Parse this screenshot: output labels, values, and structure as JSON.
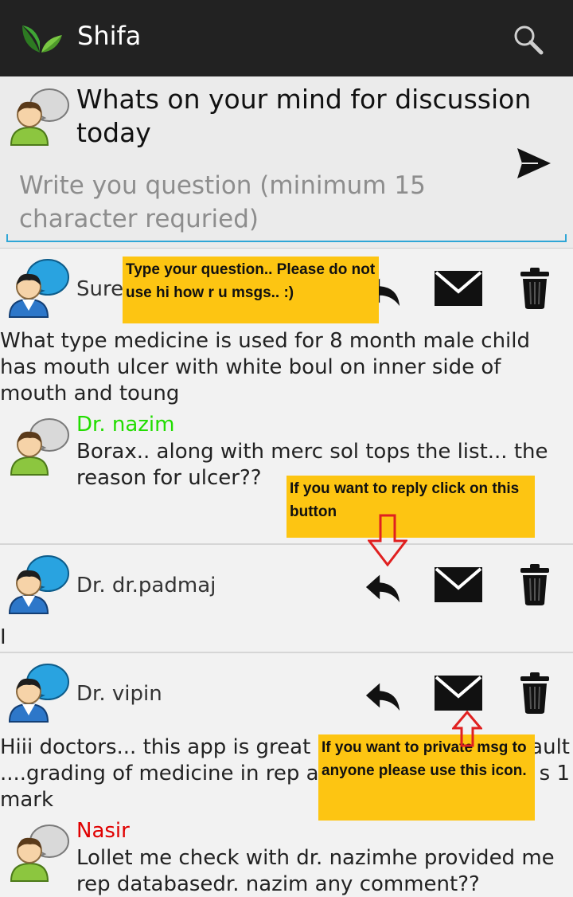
{
  "app": {
    "title": "Shifa",
    "logo_icon": "leaf-icon",
    "search_icon": "search-icon"
  },
  "composer": {
    "heading": "Whats on your mind for discussion today",
    "placeholder": "Write you question (minimum 15 character requried)",
    "send_icon": "send-icon"
  },
  "posts": [
    {
      "author": "Sure",
      "body": "What type medicine is used for 8 month male child has mouth ulcer with white boul on inner side of mouth and toung",
      "replies": [
        {
          "author": "Dr. nazim",
          "author_color": "#22dd00",
          "text": "Borax.. along with merc sol tops the list... the reason for ulcer??"
        }
      ]
    },
    {
      "author": "Dr. dr.padmaj",
      "body": "I",
      "replies": []
    },
    {
      "author": "Dr. vipin",
      "body_line1": "Hiii doctors... this app is great bi",
      "body_line1_end": "ault",
      "body_line2": "....grading of medicine in rep are",
      "body_line2_end": "s 1",
      "body_line3": "mark",
      "replies": [
        {
          "author": "Nasir",
          "author_color": "#e00000",
          "text": "Lollet me check with dr. nazimhe provided me rep databasedr. nazim any comment??"
        }
      ]
    }
  ],
  "icons": {
    "reply": "reply-icon",
    "message": "envelope-icon",
    "delete": "trash-icon",
    "avatar": "user-avatar-icon"
  },
  "callouts": {
    "question": "Type your question.. Please do not use hi how r u msgs.. :)",
    "reply": "If you want to reply click on this button",
    "private": "If you want to private msg to anyone please use this icon."
  },
  "colors": {
    "actionbar": "#222222",
    "accent": "#2fa6d6",
    "callout": "#fdc512",
    "arrow": "#e02020"
  }
}
